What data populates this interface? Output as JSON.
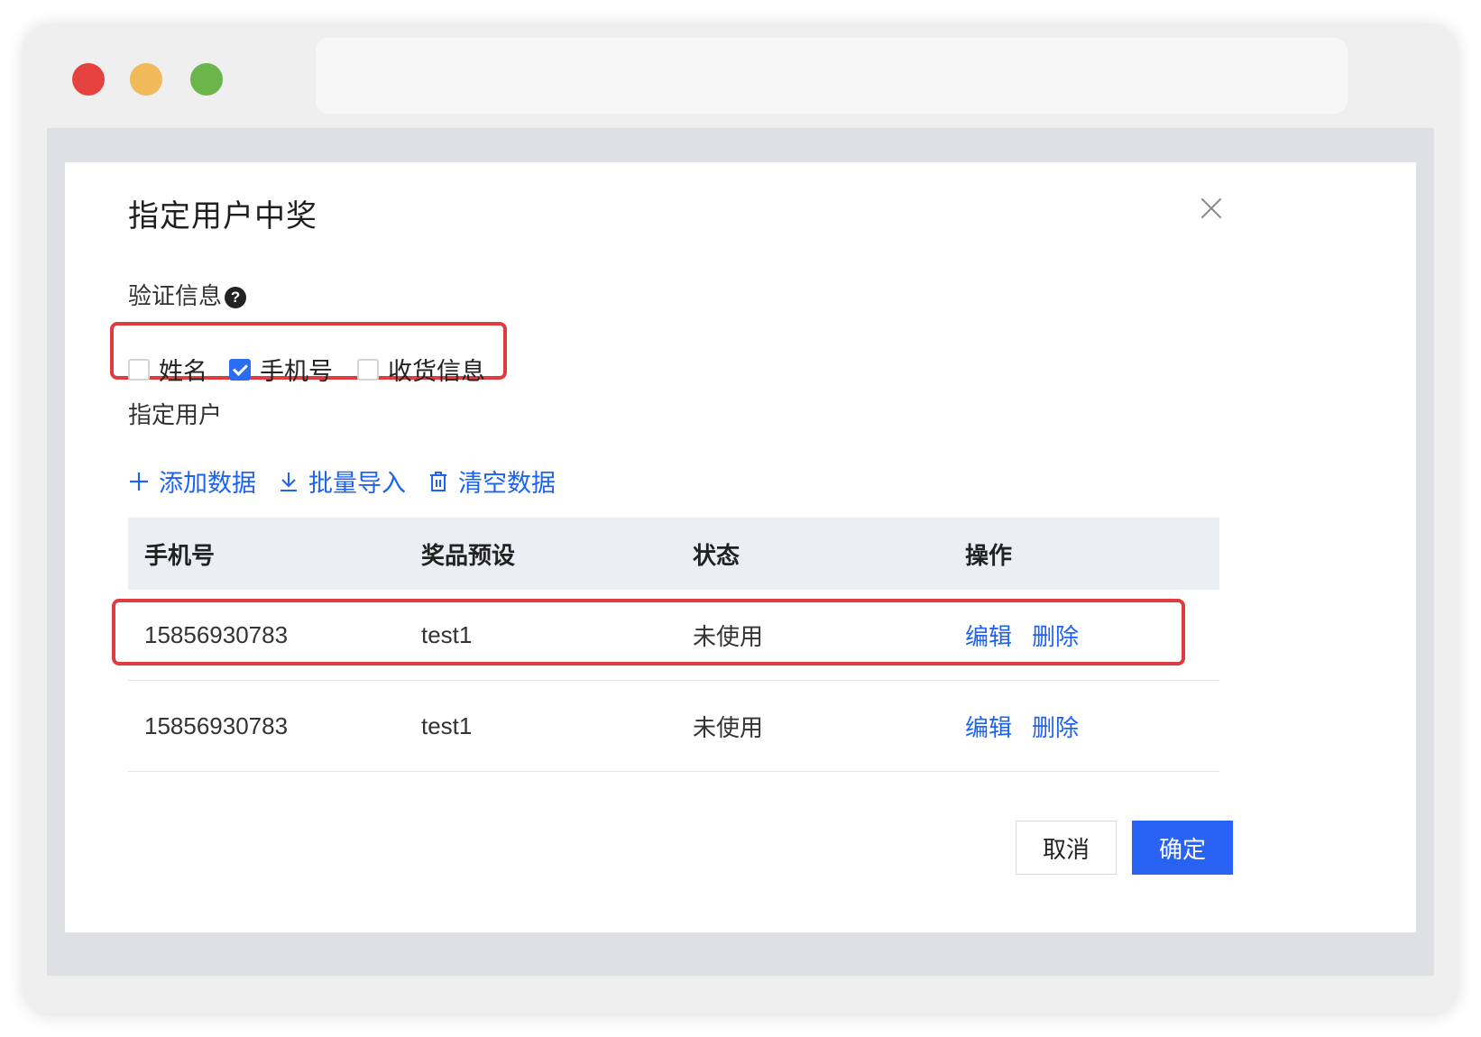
{
  "dialog": {
    "title": "指定用户中奖",
    "verify_label": "验证信息",
    "verify_options": [
      {
        "label": "姓名",
        "checked": false
      },
      {
        "label": "手机号",
        "checked": true
      },
      {
        "label": "收货信息",
        "checked": false
      }
    ],
    "assign_label": "指定用户",
    "actions": {
      "add": "添加数据",
      "import": "批量导入",
      "clear": "清空数据"
    },
    "table": {
      "headers": [
        "手机号",
        "奖品预设",
        "状态",
        "操作"
      ],
      "rows": [
        {
          "phone": "15856930783",
          "prize": "test1",
          "status": "未使用",
          "edit": "编辑",
          "delete": "删除"
        },
        {
          "phone": "15856930783",
          "prize": "test1",
          "status": "未使用",
          "edit": "编辑",
          "delete": "删除"
        }
      ]
    },
    "footer": {
      "cancel": "取消",
      "confirm": "确定"
    }
  },
  "colors": {
    "accent": "#2a63f3",
    "link": "#1e63f0",
    "highlight": "#e03b3f"
  },
  "icons": {
    "help": "question-circle-icon",
    "close": "close-icon",
    "add": "plus-icon",
    "import": "download-icon",
    "clear": "trash-icon"
  }
}
